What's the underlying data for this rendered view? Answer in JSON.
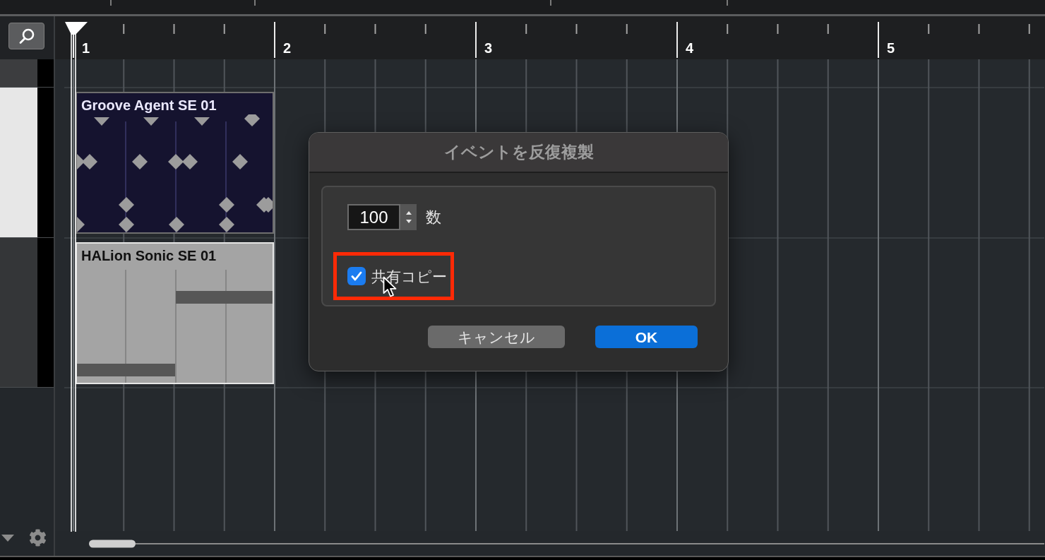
{
  "ruler": {
    "bars": [
      "1",
      "2",
      "3",
      "4",
      "5"
    ]
  },
  "tracks": [
    {
      "selected": false
    },
    {
      "selected": true
    },
    {
      "selected": false
    }
  ],
  "events": [
    {
      "name": "Groove Agent SE 01",
      "kind": "drum",
      "selected": true
    },
    {
      "name": "HALion Sonic SE 01",
      "kind": "instrument",
      "selected": false
    }
  ],
  "dialog": {
    "title": "イベントを反復複製",
    "count_field": {
      "value": "100",
      "label": "数"
    },
    "shared_copy_option": {
      "label": "共有コピー",
      "checked": true,
      "highlighted": true
    },
    "buttons": [
      {
        "label": "キャンセル",
        "kind": "cancel"
      },
      {
        "label": "OK",
        "kind": "default"
      }
    ]
  }
}
